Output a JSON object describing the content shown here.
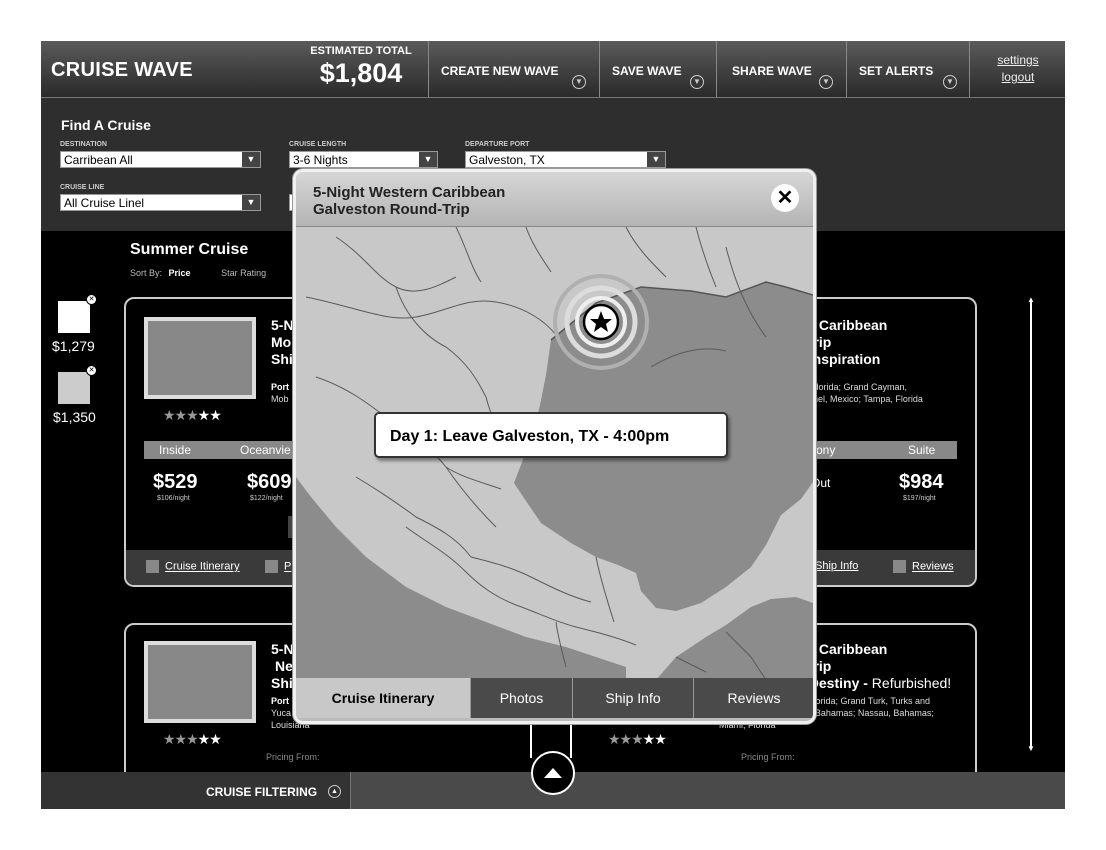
{
  "header": {
    "brand": "CRUISE WAVE",
    "estimated_label": "ESTIMATED TOTAL",
    "estimated_value": "$1,804",
    "buttons": [
      "CREATE NEW WAVE",
      "SAVE WAVE",
      "SHARE WAVE",
      "SET ALERTS"
    ],
    "settings": "settings",
    "logout": "logout"
  },
  "find": {
    "title": "Find A Cruise",
    "destination_label": "DESTINATION",
    "destination_value": "Carribean All",
    "length_label": "CRUISE LENGTH",
    "length_value": "3-6 Nights",
    "port_label": "DEPARTURE PORT",
    "port_value": "Galveston, TX",
    "line_label": "CRUISE LINE",
    "line_value": "All Cruise Linel"
  },
  "results": {
    "title": "Summer Cruise",
    "sort_label": "Sort By:",
    "sort_options": [
      "Price",
      "Star Rating"
    ]
  },
  "thumbs": [
    {
      "price": "$1,279"
    },
    {
      "price": "$1,350"
    }
  ],
  "cards": [
    {
      "title_left": [
        "5-N",
        "Mo",
        "Shi"
      ],
      "ports_label_left": "Port",
      "ports_left": "Mob",
      "title_right": [
        "rn Caribbean",
        "-Trip",
        "l Inspiration"
      ],
      "ports_right": [
        "a, Florida; Grand Cayman,",
        "zumel, Mexico; Tampa, Florida"
      ],
      "stars_filled": 3,
      "cabins": [
        "Inside",
        "Oceanvie",
        "cony",
        "Suite"
      ],
      "prices": [
        "$529",
        "$609",
        "d Out",
        "$984"
      ],
      "per_night": [
        "$106/night",
        "$122/night",
        "",
        "$197/night"
      ],
      "footer_links": [
        "Cruise Itinerary",
        "P",
        "Ship Info",
        "Reviews"
      ]
    },
    {
      "title_left": [
        "5-N",
        "Ne",
        "Shi"
      ],
      "ports_label_left": "Port",
      "ports_left": [
        "Yuca",
        "Louisiana"
      ],
      "title_right": [
        "rn Caribbean",
        "-Trip",
        "l Destiny - "
      ],
      "title_right_extra": "Refurbished!",
      "ports_right": [
        "i, Florida; Grand Turk, Turks and",
        "ay, Bahamas; Nassau, Bahamas;",
        "Miami, Florida"
      ],
      "stars_filled": 3,
      "pricing_from": "Pricing From:"
    }
  ],
  "footer": {
    "filter_label": "CRUISE FILTERING"
  },
  "modal": {
    "title_line1": "5-Night Western Caribbean",
    "title_line2": "Galveston Round-Trip",
    "callout": "Day 1: Leave Galveston, TX - 4:00pm",
    "tabs": [
      "Cruise Itinerary",
      "Photos",
      "Ship Info",
      "Reviews"
    ],
    "active_tab": "Cruise Itinerary"
  },
  "colors": {
    "land": "#c8c8c8",
    "water": "#8c8c8c",
    "header_dark": "#2a2a2a"
  }
}
